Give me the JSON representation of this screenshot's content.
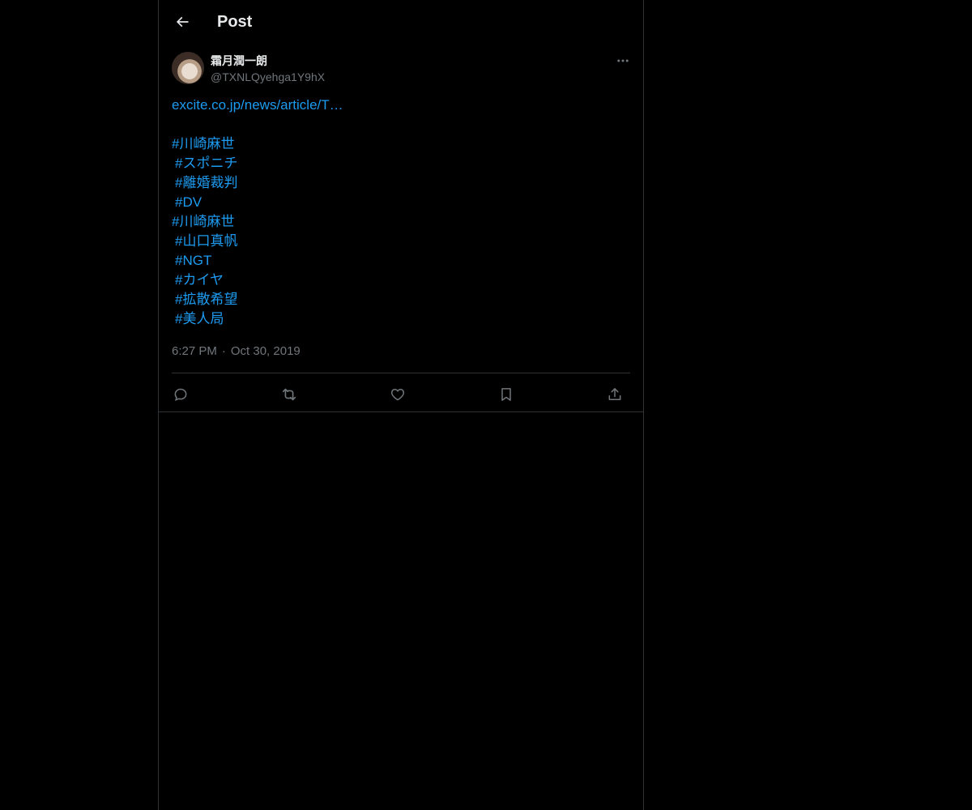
{
  "header": {
    "title": "Post",
    "back_icon": "arrow-left-icon"
  },
  "post": {
    "author": {
      "display_name": "霜月潤一朗",
      "handle": "@TXNLQyehga1Y9hX"
    },
    "link_text": "excite.co.jp/news/article/T…",
    "hashtags": [
      "#川崎麻世",
      "#スポニチ",
      "#離婚裁判",
      "#DV",
      "#川崎麻世",
      "#山口真帆",
      "#NGT",
      "#カイヤ",
      "#拡散希望",
      "#美人局"
    ],
    "time": "6:27 PM",
    "separator": "·",
    "date": "Oct 30, 2019"
  },
  "actions": [
    {
      "name": "reply",
      "icon": "reply-icon"
    },
    {
      "name": "repost",
      "icon": "repost-icon"
    },
    {
      "name": "like",
      "icon": "heart-icon"
    },
    {
      "name": "bookmark",
      "icon": "bookmark-icon"
    },
    {
      "name": "share",
      "icon": "share-icon"
    }
  ],
  "colors": {
    "background": "#000000",
    "text": "#e7e9ea",
    "muted": "#71767b",
    "accent": "#1d9bf0",
    "border": "#2f3336"
  }
}
